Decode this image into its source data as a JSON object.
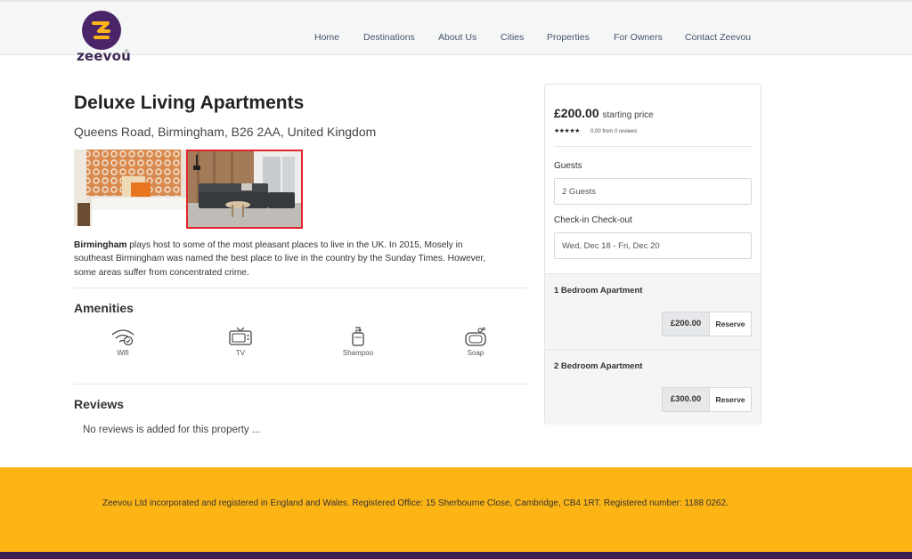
{
  "brand": {
    "name": "zeevou",
    "reg": "®",
    "colors": {
      "purple": "#4a2469",
      "yellow": "#fdb515"
    }
  },
  "nav": {
    "items": [
      {
        "label": "Home"
      },
      {
        "label": "Destinations"
      },
      {
        "label": "About Us"
      },
      {
        "label": "Cities"
      },
      {
        "label": "Properties"
      },
      {
        "label": "For Owners"
      },
      {
        "label": "Contact Zeevou"
      }
    ]
  },
  "property": {
    "title": "Deluxe Living Apartments",
    "address": "Queens Road, Birmingham, B26 2AA, United Kingdom",
    "description_bold": "Birmingham",
    "description_rest": " plays host to some of the most pleasant places to live in the UK. In 2015, Mosely in southeast Birmingham was named the best place to live in the country by the Sunday Times. However, some areas suffer from concentrated crime."
  },
  "amenities": {
    "heading": "Amenities",
    "items": [
      {
        "label": "Wifi",
        "icon": "wifi-icon"
      },
      {
        "label": "TV",
        "icon": "tv-icon"
      },
      {
        "label": "Shampoo",
        "icon": "shampoo-icon"
      },
      {
        "label": "Soap",
        "icon": "soap-icon"
      }
    ]
  },
  "reviews": {
    "heading": "Reviews",
    "empty_text": "No reviews is added for this property ..."
  },
  "booking": {
    "price": "£200.00",
    "price_note": "starting price",
    "stars": "★★★★★",
    "rating_text": "0.00 from 0 reviews",
    "guests_label": "Guests",
    "guests_value": "2 Guests",
    "dates_label": "Check-in Check-out",
    "dates_value": "Wed, Dec 18 - Fri, Dec 20",
    "rooms": [
      {
        "name": "1 Bedroom Apartment",
        "price": "£200.00",
        "action": "Reserve"
      },
      {
        "name": "2 Bedroom Apartment",
        "price": "£300.00",
        "action": "Reserve"
      }
    ]
  },
  "footer": {
    "text": "Zeevou Ltd incorporated and registered in England and Wales. Registered Office: 15 Sherbourne Close, Cambridge, CB4 1RT. Registered number: 1188 0262."
  }
}
